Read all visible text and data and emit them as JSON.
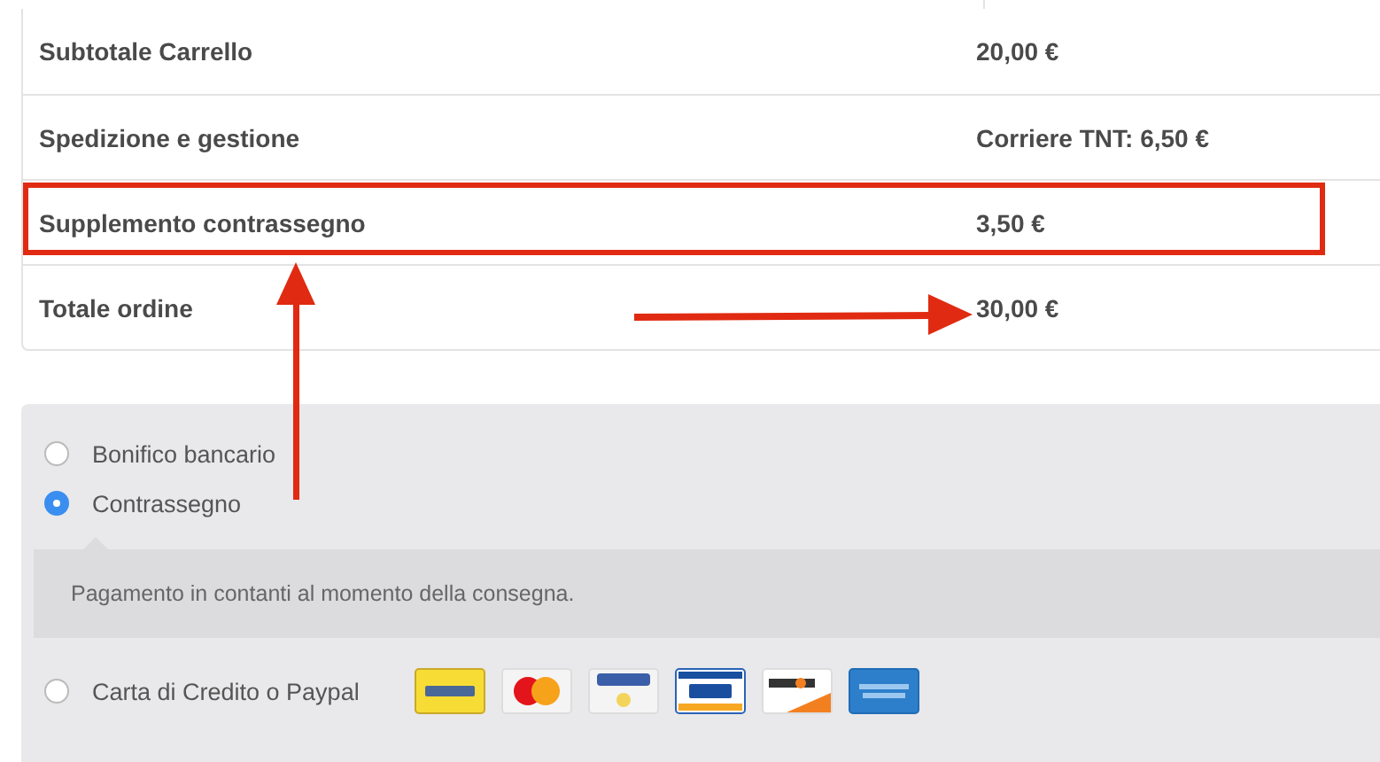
{
  "order_totals": [
    {
      "label": "Subtotale Carrello",
      "value": "20,00 €",
      "highlighted": false
    },
    {
      "label": "Spedizione e gestione",
      "value": "Corriere TNT: 6,50 €",
      "highlighted": false
    },
    {
      "label": "Supplemento contrassegno",
      "value": "3,50 €",
      "highlighted": true
    },
    {
      "label": "Totale ordine",
      "value": "30,00 €",
      "highlighted": false
    }
  ],
  "payment_methods": [
    {
      "label": "Bonifico bancario",
      "selected": false
    },
    {
      "label": "Contrassegno",
      "selected": true,
      "description": "Pagamento in contanti al momento della consegna."
    },
    {
      "label": "Carta di Credito o Paypal",
      "selected": false,
      "cards": [
        {
          "kind": "postepay"
        },
        {
          "kind": "mastercard"
        },
        {
          "kind": "paypal"
        },
        {
          "kind": "visa"
        },
        {
          "kind": "discover"
        },
        {
          "kind": "amex"
        }
      ]
    }
  ]
}
